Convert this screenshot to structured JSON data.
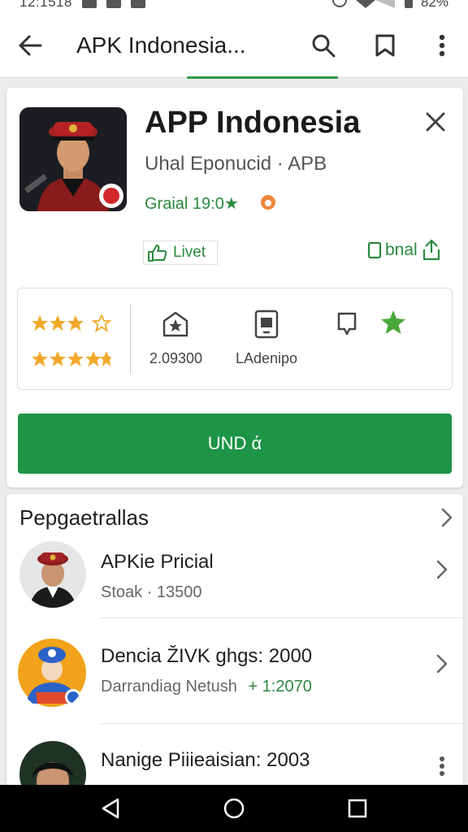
{
  "status_bar": {
    "time": "12:1518",
    "battery": "82%"
  },
  "app_bar": {
    "title": "APK Indonesia..."
  },
  "app": {
    "name": "APP Indonesia",
    "developer": "Uhal Eponucid · APB",
    "price_label": "Graial 19:0★",
    "live_label": "Livet",
    "save_label": "bnal",
    "stat_reviews": "2.09300",
    "stat_category": "LAdenipo",
    "install_label": "UND ά",
    "accent_color": "#1e9447"
  },
  "related": {
    "header": "Pepgaetrallas",
    "items": [
      {
        "title": "APKie Pricial",
        "subtitle": "Stoak · 13500"
      },
      {
        "title": "Dencia ŽIVK ghgs: 2000",
        "subtitle": "Darrandiag Netush",
        "subtitle_extra": "+ 1:2070"
      },
      {
        "title": "Nanige Piiieaisian: 2003",
        "subtitle": ""
      }
    ]
  }
}
